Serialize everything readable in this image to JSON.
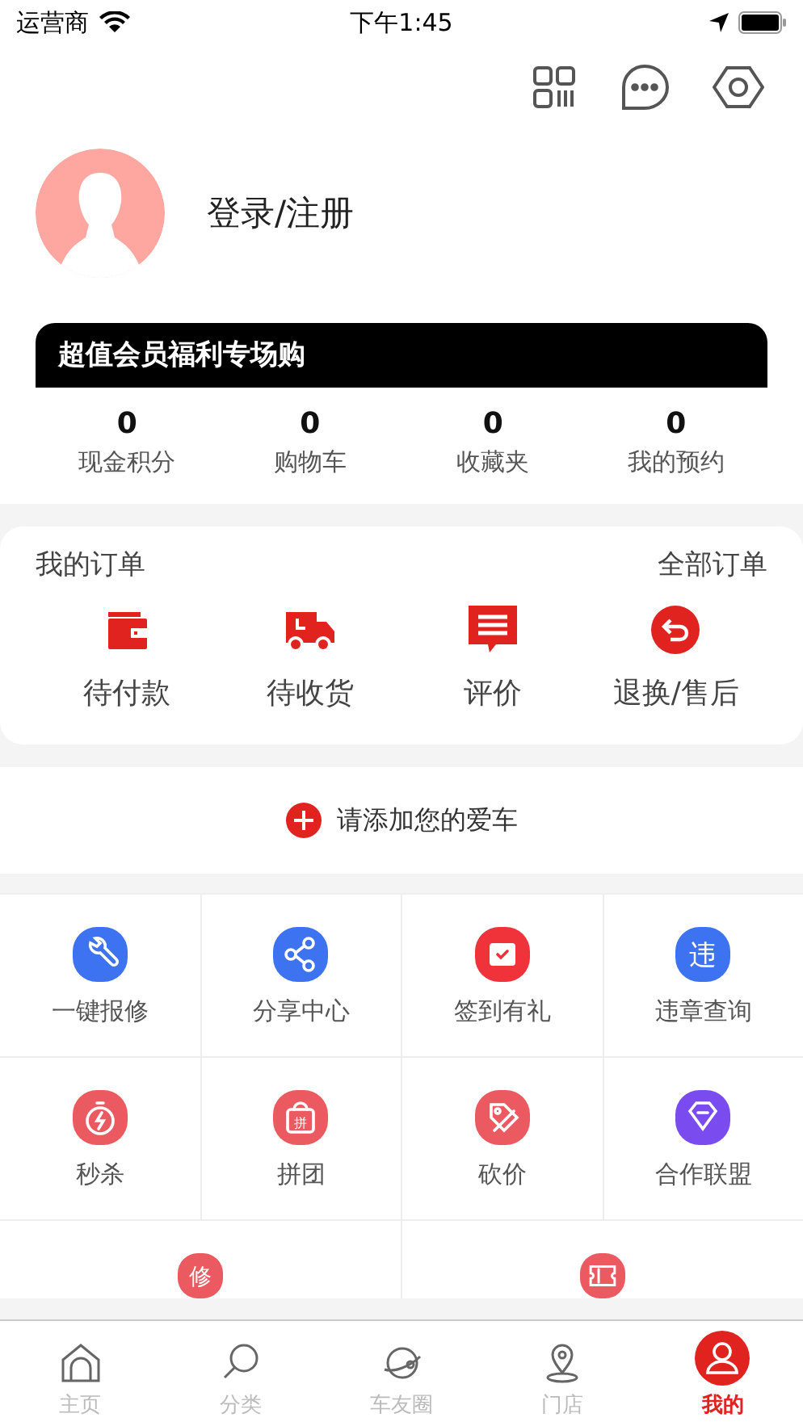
{
  "status_bar": {
    "carrier": "运营商",
    "time": "下午1:45"
  },
  "profile": {
    "login": "登录/注册"
  },
  "member_banner": "超值会员福利专场购",
  "stats": [
    {
      "value": "0",
      "label": "现金积分"
    },
    {
      "value": "0",
      "label": "购物车"
    },
    {
      "value": "0",
      "label": "收藏夹"
    },
    {
      "value": "0",
      "label": "我的预约"
    }
  ],
  "orders": {
    "title": "我的订单",
    "all": "全部订单",
    "items": [
      {
        "kind": "wallet",
        "label": "待付款"
      },
      {
        "kind": "truck",
        "label": "待收货"
      },
      {
        "kind": "comment",
        "label": "评价"
      },
      {
        "kind": "return",
        "label": "退换/售后"
      }
    ]
  },
  "add_car": "请添加您的爱车",
  "services": [
    {
      "kind": "wrench",
      "color": "#3d72f0",
      "label": "一键报修"
    },
    {
      "kind": "share",
      "color": "#3d72f0",
      "label": "分享中心"
    },
    {
      "kind": "calendar",
      "color": "#f0323a",
      "label": "签到有礼"
    },
    {
      "kind": "glyph",
      "glyph": "违",
      "color": "#3d72f0",
      "label": "违章查询"
    },
    {
      "kind": "stopwatch",
      "color": "#ea5a60",
      "label": "秒杀"
    },
    {
      "kind": "bag",
      "glyph": "拼",
      "color": "#ea5a60",
      "label": "拼团"
    },
    {
      "kind": "tag",
      "color": "#ea5a60",
      "label": "砍价"
    },
    {
      "kind": "diamond",
      "color": "#7a4cf0",
      "label": "合作联盟"
    },
    {
      "kind": "glyph",
      "glyph": "修",
      "color": "#ea5a60"
    },
    {
      "kind": "ticket",
      "color": "#ea5a60"
    }
  ],
  "tab_bar": [
    {
      "kind": "home",
      "label": "主页",
      "selected": false
    },
    {
      "kind": "search",
      "label": "分类",
      "selected": false
    },
    {
      "kind": "planet",
      "label": "车友圈",
      "selected": false
    },
    {
      "kind": "pin",
      "label": "门店",
      "selected": false
    },
    {
      "kind": "person",
      "label": "我的",
      "selected": true
    }
  ]
}
